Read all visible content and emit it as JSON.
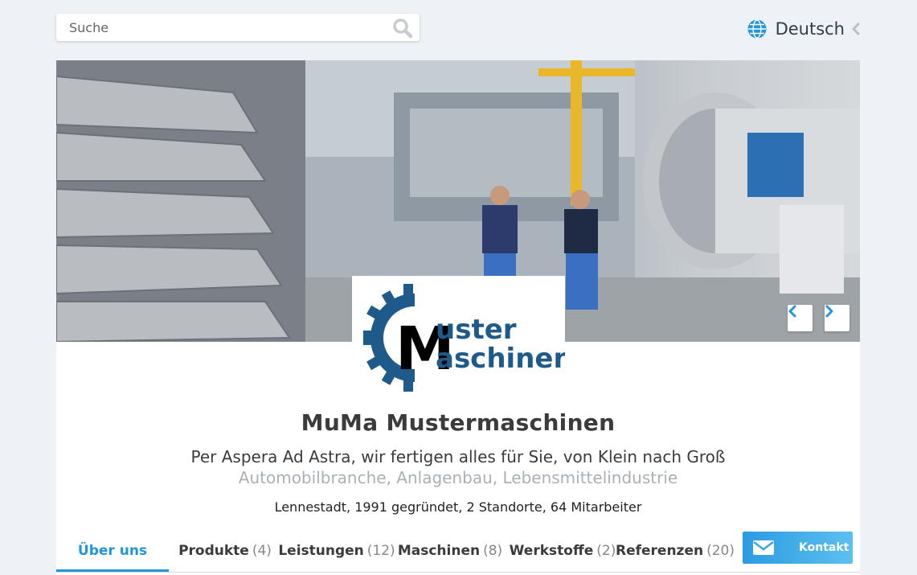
{
  "search": {
    "placeholder": "Suche",
    "icon": "search-icon"
  },
  "language": {
    "label": "Deutsch",
    "icon": "globe-icon"
  },
  "hero": {
    "prev_icon": "chevron-left-icon",
    "next_icon": "chevron-right-icon"
  },
  "logo": {
    "line1": "uster",
    "line2": "aschinen",
    "letter": "M"
  },
  "company": {
    "name": "MuMa Mustermaschinen",
    "slogan": "Per Aspera Ad Astra, wir fertigen alles für Sie, von Klein nach Groß",
    "industries": "Automobilbranche, Anlagenbau, Lebensmittelindustrie",
    "facts": "Lennestadt, 1991 gegründet, 2 Standorte, 64 Mitarbeiter"
  },
  "tabs": [
    {
      "label": "Über uns",
      "count": ""
    },
    {
      "label": "Produkte",
      "count": "(4)"
    },
    {
      "label": "Leistungen",
      "count": "(12)"
    },
    {
      "label": "Maschinen",
      "count": "(8)"
    },
    {
      "label": "Werkstoffe",
      "count": "(2)"
    },
    {
      "label": "Referenzen",
      "count": "(20)"
    }
  ],
  "contact": {
    "label": "Kontakt",
    "icon": "envelope-icon"
  },
  "colors": {
    "accent": "#2196d9",
    "logo_blue": "#1e5a8a",
    "text": "#3b3b3b",
    "muted": "#a9b0b6"
  }
}
